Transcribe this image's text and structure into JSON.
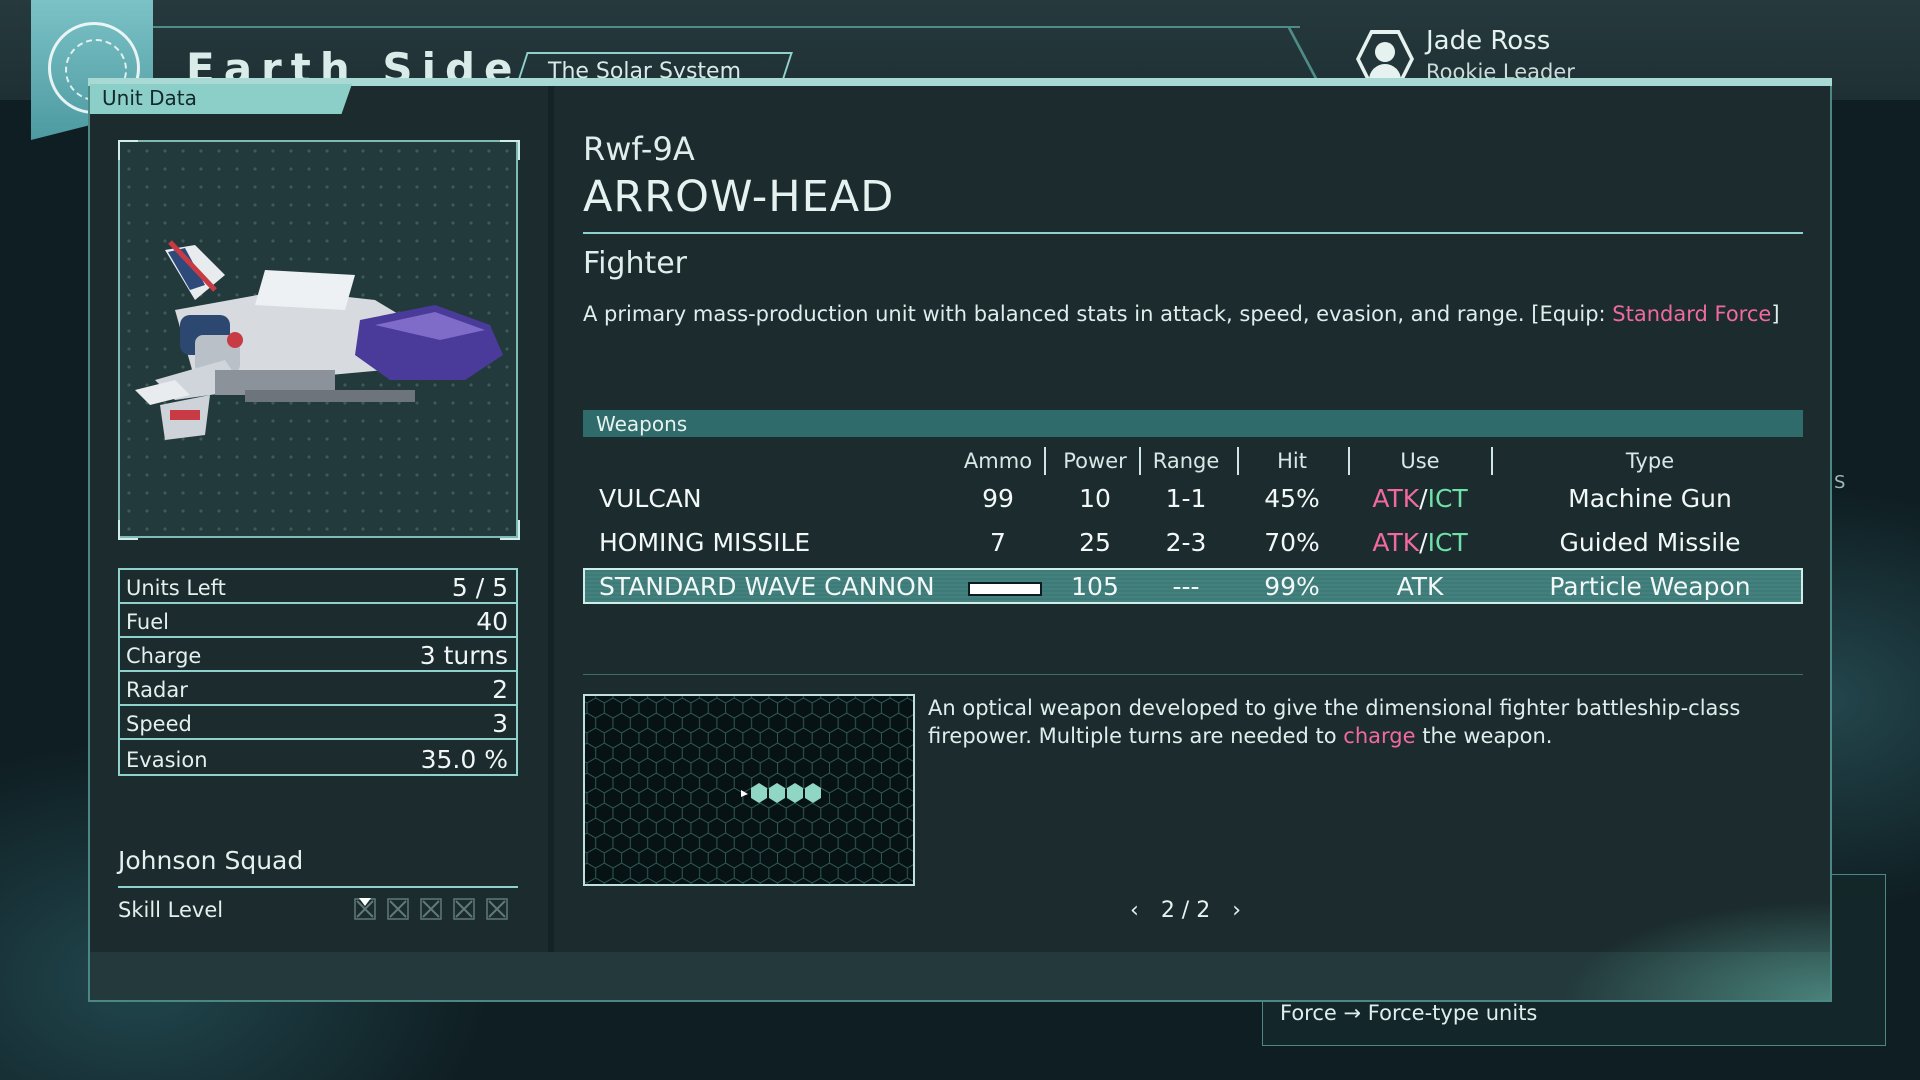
{
  "header": {
    "title": "Earth Side",
    "region": "The Solar System",
    "player_name": "Jade Ross",
    "player_rank": "Rookie Leader"
  },
  "panel": {
    "tab_label": "Unit Data"
  },
  "unit": {
    "model": "Rwf-9A",
    "name": "ARROW-HEAD",
    "class": "Fighter",
    "description_pre": "A primary mass-production unit with balanced stats in attack, speed, evasion, and range. [Equip: ",
    "description_link": "Standard Force",
    "description_post": "]"
  },
  "stats": [
    {
      "label": "Units Left",
      "value": "5 / 5"
    },
    {
      "label": "Fuel",
      "value": "40"
    },
    {
      "label": "Charge",
      "value": "3 turns"
    },
    {
      "label": "Radar",
      "value": "2"
    },
    {
      "label": "Speed",
      "value": "3"
    },
    {
      "label": "Evasion",
      "value": "35.0 %"
    }
  ],
  "squad": {
    "name": "Johnson Squad",
    "skill_label": "Skill Level",
    "skill_level": 1,
    "skill_max": 5
  },
  "weapons": {
    "title": "Weapons",
    "headers": {
      "ammo": "Ammo",
      "power": "Power",
      "range": "Range",
      "hit": "Hit",
      "use": "Use",
      "type": "Type"
    },
    "rows": [
      {
        "name": "VULCAN",
        "ammo": "99",
        "power": "10",
        "range": "1-1",
        "hit": "45%",
        "use_atk": "ATK",
        "use_sep": "/",
        "use_ict": "ICT",
        "type": "Machine Gun"
      },
      {
        "name": "HOMING MISSILE",
        "ammo": "7",
        "power": "25",
        "range": "2-3",
        "hit": "70%",
        "use_atk": "ATK",
        "use_sep": "/",
        "use_ict": "ICT",
        "type": "Guided Missile"
      },
      {
        "name": "STANDARD WAVE CANNON",
        "ammo_fill": 1.0,
        "power": "105",
        "range": "---",
        "hit": "99%",
        "use_atk": "ATK",
        "type": "Particle Weapon"
      }
    ]
  },
  "weapon_detail": {
    "text_pre": "An optical weapon developed to give the dimensional fighter battleship-class firepower. Multiple turns are needed to ",
    "text_link": "charge",
    "text_post": " the weapon."
  },
  "pager": {
    "prev": "‹",
    "label": "2 / 2",
    "next": "›"
  },
  "hint": {
    "text": "Force → Force-type units"
  },
  "colors": {
    "accent": "#8fd1cc",
    "atk": "#f06aa0",
    "ict": "#6ee0a8"
  }
}
